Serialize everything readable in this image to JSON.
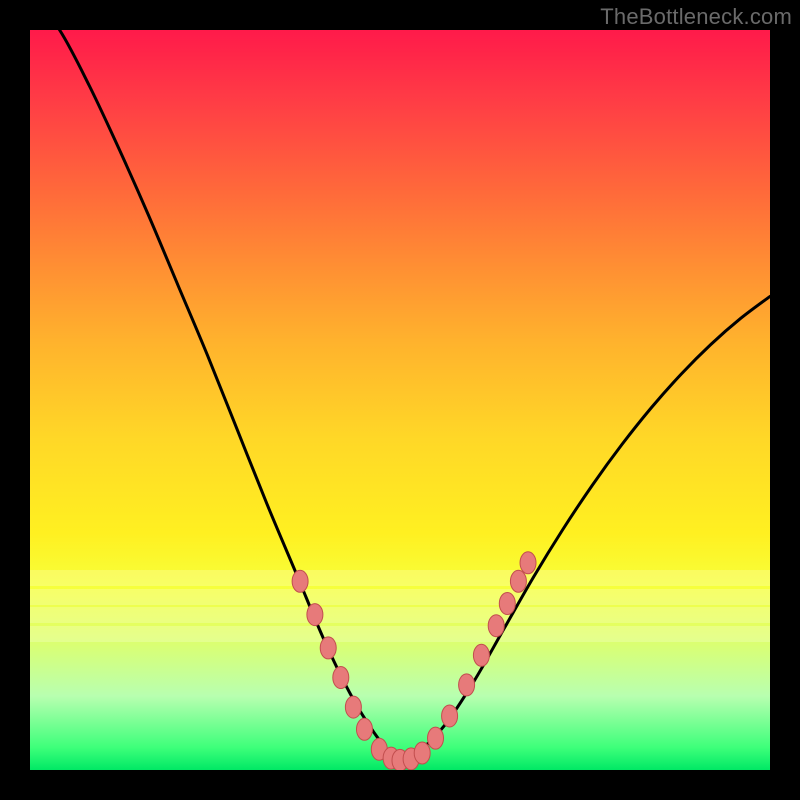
{
  "watermark": "TheBottleneck.com",
  "colors": {
    "frame_bg": "#000000",
    "curve_stroke": "#000000",
    "marker_fill": "#e77a7a",
    "marker_stroke": "#c24e4e",
    "gradient_top": "#ff1a4a",
    "gradient_bottom": "#00e865"
  },
  "chart_data": {
    "type": "line",
    "title": "",
    "xlabel": "",
    "ylabel": "",
    "xlim": [
      0,
      100
    ],
    "ylim": [
      0,
      100
    ],
    "grid": false,
    "legend": false,
    "note": "Axes are unlabeled in source image; values are estimated from pixel positions. y is percent of plot height from bottom, x is percent of plot width from left.",
    "curve": {
      "name": "bottleneck-curve",
      "x": [
        0,
        4,
        8,
        12,
        16,
        20,
        24,
        28,
        32,
        36,
        40,
        44,
        48,
        50,
        52,
        56,
        60,
        64,
        68,
        72,
        76,
        80,
        84,
        88,
        92,
        96,
        100
      ],
      "y": [
        105,
        100,
        92.5,
        84,
        75,
        65.5,
        56,
        46,
        36,
        26.5,
        17,
        9,
        3,
        1.3,
        2,
        6,
        12,
        19,
        26,
        32.5,
        38.5,
        44,
        49,
        53.5,
        57.5,
        61,
        64
      ]
    },
    "markers": {
      "name": "highlighted-points",
      "points": [
        {
          "x": 36.5,
          "y": 25.5
        },
        {
          "x": 38.5,
          "y": 21.0
        },
        {
          "x": 40.3,
          "y": 16.5
        },
        {
          "x": 42.0,
          "y": 12.5
        },
        {
          "x": 43.7,
          "y": 8.5
        },
        {
          "x": 45.2,
          "y": 5.5
        },
        {
          "x": 47.2,
          "y": 2.8
        },
        {
          "x": 48.8,
          "y": 1.6
        },
        {
          "x": 50.0,
          "y": 1.3
        },
        {
          "x": 51.5,
          "y": 1.5
        },
        {
          "x": 53.0,
          "y": 2.3
        },
        {
          "x": 54.8,
          "y": 4.3
        },
        {
          "x": 56.7,
          "y": 7.3
        },
        {
          "x": 59.0,
          "y": 11.5
        },
        {
          "x": 61.0,
          "y": 15.5
        },
        {
          "x": 63.0,
          "y": 19.5
        },
        {
          "x": 64.5,
          "y": 22.5
        },
        {
          "x": 66.0,
          "y": 25.5
        },
        {
          "x": 67.3,
          "y": 28.0
        }
      ]
    },
    "light_bands_y": [
      73,
      75.5,
      78,
      80.5
    ]
  }
}
